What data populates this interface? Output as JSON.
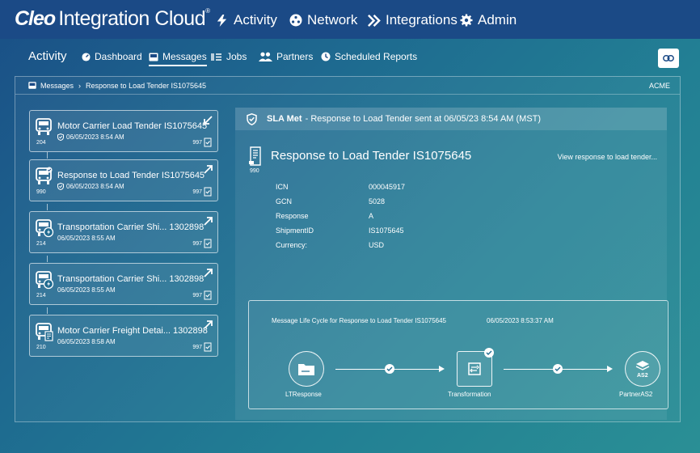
{
  "brand": {
    "name_bold": "Cleo",
    "name_rest": "Integration Cloud",
    "tm": "®"
  },
  "topnav": [
    {
      "label": "Activity",
      "icon": "activity-icon"
    },
    {
      "label": "Network",
      "icon": "network-icon"
    },
    {
      "label": "Integrations",
      "icon": "integrations-icon"
    },
    {
      "label": "Admin",
      "icon": "gear-icon"
    }
  ],
  "subnav": {
    "title": "Activity",
    "tabs": [
      {
        "label": "Dashboard",
        "icon": "dashboard-icon",
        "active": false
      },
      {
        "label": "Messages",
        "icon": "inbox-icon",
        "active": true
      },
      {
        "label": "Jobs",
        "icon": "jobs-icon",
        "active": false
      },
      {
        "label": "Partners",
        "icon": "partners-icon",
        "active": false
      },
      {
        "label": "Scheduled Reports",
        "icon": "clock-icon",
        "active": false
      }
    ]
  },
  "breadcrumb": {
    "root": "Messages",
    "current": "Response to Load Tender IS1075645",
    "org": "ACME"
  },
  "messages": [
    {
      "code": "204",
      "title": "Motor Carrier Load Tender IS1075645",
      "datetime": "06/05/2023 8:54 AM",
      "sla_shield": true,
      "ack": "997",
      "direction": "inbound"
    },
    {
      "code": "990",
      "title": "Response to Load Tender IS1075645",
      "datetime": "06/05/2023 8:54 AM",
      "sla_shield": true,
      "ack": "997",
      "direction": "outbound"
    },
    {
      "code": "214",
      "title": "Transportation Carrier Shi... 1302898",
      "datetime": "06/05/2023 8:55 AM",
      "sla_shield": false,
      "ack": "997",
      "direction": "outbound"
    },
    {
      "code": "214",
      "title": "Transportation Carrier Shi... 1302898",
      "datetime": "06/05/2023 8:55 AM",
      "sla_shield": false,
      "ack": "997",
      "direction": "outbound"
    },
    {
      "code": "210",
      "title": "Motor Carrier Freight Detai... 1302898",
      "datetime": "06/05/2023 8:58 AM",
      "sla_shield": false,
      "ack": "997",
      "direction": "outbound"
    }
  ],
  "detail": {
    "sla_status": "SLA Met",
    "sla_text": "- Response to Load Tender sent at 06/05/23 8:54 AM (MST)",
    "title": "Response to Load Tender IS1075645",
    "code": "990",
    "view_link": "View response to load tender...",
    "fields": [
      {
        "key": "ICN",
        "value": "000045917"
      },
      {
        "key": "GCN",
        "value": "5028"
      },
      {
        "key": "Response",
        "value": "A"
      },
      {
        "key": "ShipmentID",
        "value": "IS1075645"
      },
      {
        "key": "Currency:",
        "value": "USD"
      }
    ],
    "lifecycle": {
      "title": "Message Life Cycle for Response to Load Tender IS1075645",
      "timestamp": "06/05/2023 8:53:37 AM",
      "nodes": [
        {
          "label": "LTResponse",
          "icon": "folder-icon"
        },
        {
          "label": "Transformation",
          "icon": "transformation-icon"
        },
        {
          "label": "PartnerAS2",
          "icon": "as2-icon",
          "badge": "AS2"
        }
      ]
    }
  },
  "colors": {
    "topbar": "#1b4a86",
    "accent": "#ffffff",
    "icon_dark": "#1b4a86"
  }
}
